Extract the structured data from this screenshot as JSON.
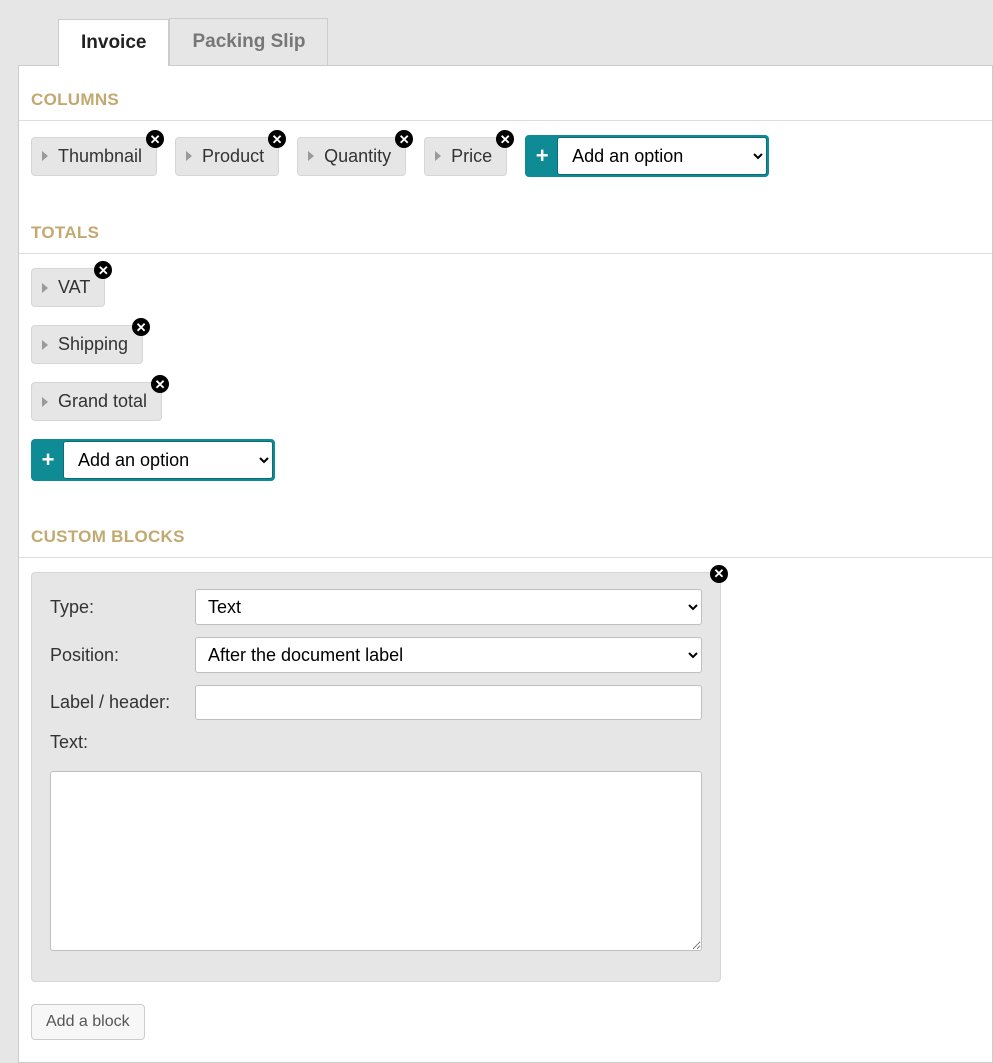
{
  "tabs": [
    {
      "label": "Invoice",
      "active": true
    },
    {
      "label": "Packing Slip",
      "active": false
    }
  ],
  "sections": {
    "columns": {
      "title": "COLUMNS",
      "chips": [
        "Thumbnail",
        "Product",
        "Quantity",
        "Price"
      ],
      "add_option_label": "Add an option"
    },
    "totals": {
      "title": "TOTALS",
      "chips": [
        "VAT",
        "Shipping",
        "Grand total"
      ],
      "add_option_label": "Add an option"
    },
    "custom_blocks": {
      "title": "CUSTOM BLOCKS",
      "block": {
        "type_label": "Type:",
        "type_value": "Text",
        "position_label": "Position:",
        "position_value": "After the document label",
        "header_label": "Label / header:",
        "header_value": "",
        "text_label": "Text:",
        "text_value": ""
      },
      "add_block_label": "Add a block"
    }
  }
}
